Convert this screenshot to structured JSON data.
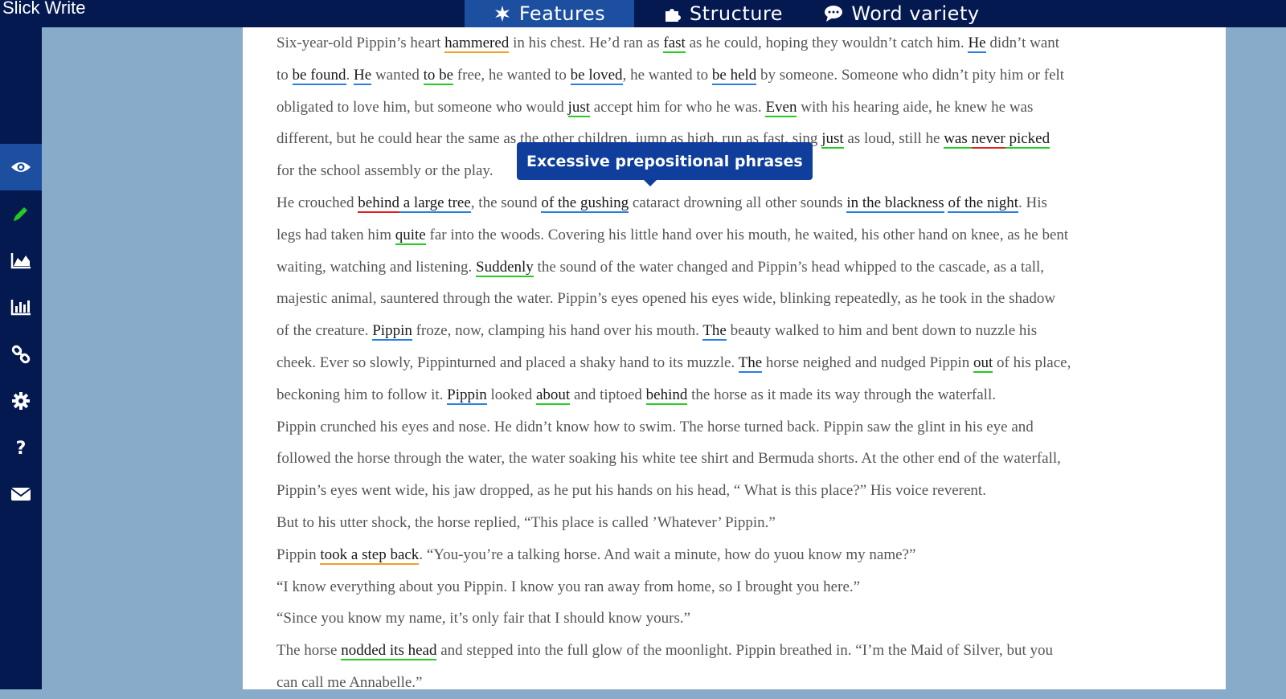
{
  "app": {
    "title": "Slick Write"
  },
  "tabs": [
    {
      "label": "Features",
      "icon": "puzzle-star-icon",
      "active": true
    },
    {
      "label": "Structure",
      "icon": "puzzle-icon",
      "active": false
    },
    {
      "label": "Word variety",
      "icon": "speech-bubble-icon",
      "active": false
    }
  ],
  "sidebar": {
    "items": [
      {
        "icon": "eye-icon",
        "active": true
      },
      {
        "icon": "pencil-icon",
        "active": false
      },
      {
        "icon": "area-chart-icon",
        "active": false
      },
      {
        "icon": "bar-chart-icon",
        "active": false
      },
      {
        "icon": "link-icon",
        "active": false
      },
      {
        "icon": "gear-icon",
        "active": false
      },
      {
        "icon": "question-icon",
        "active": false
      },
      {
        "icon": "envelope-icon",
        "active": false
      }
    ]
  },
  "colors": {
    "topbar": "#04194f",
    "active_tab": "#1c4fa0",
    "background": "#87abc9",
    "underline_orange": "#f0a020",
    "underline_green": "#22cc22",
    "underline_blue": "#2a7ee0",
    "underline_red": "#e02020"
  },
  "tooltip": {
    "text": "Excessive prepositional phrases"
  },
  "document": {
    "lines": [
      [
        [
          "Six-year-old Pippin’s heart ",
          ""
        ],
        [
          "hammered",
          "orange"
        ],
        [
          " in his chest. He’d ran as ",
          ""
        ],
        [
          "fast",
          "green"
        ],
        [
          " as he could, hoping they wouldn’t catch him. ",
          ""
        ],
        [
          "He",
          "blue"
        ],
        [
          " didn’t want",
          ""
        ]
      ],
      [
        [
          "to ",
          ""
        ],
        [
          "be found",
          "blue"
        ],
        [
          ". ",
          ""
        ],
        [
          "He",
          "blue"
        ],
        [
          " wanted ",
          ""
        ],
        [
          "to be",
          "green"
        ],
        [
          " free, he wanted to ",
          ""
        ],
        [
          "be loved",
          "blue"
        ],
        [
          ", he wanted to ",
          ""
        ],
        [
          "be held",
          "blue"
        ],
        [
          " by someone. Someone who didn’t pity him or felt",
          ""
        ]
      ],
      [
        [
          "obligated to love him, but someone who would ",
          ""
        ],
        [
          "just",
          "green"
        ],
        [
          " accept him for who he was. ",
          ""
        ],
        [
          "Even",
          "green"
        ],
        [
          " with his hearing aide, he knew he was",
          ""
        ]
      ],
      [
        [
          "different, but he could hear the same as the other children, jump as high, run as fast, sing ",
          ""
        ],
        [
          "just",
          "green"
        ],
        [
          " as loud, still he ",
          ""
        ],
        [
          "was ",
          "green"
        ],
        [
          "never",
          "red"
        ],
        [
          " picked",
          "green"
        ]
      ],
      [
        [
          "for the school assembly or the play.",
          ""
        ]
      ],
      [
        [
          "He crouched ",
          ""
        ],
        [
          "behind",
          "red"
        ],
        [
          " a large tree",
          "blue"
        ],
        [
          ", the sound ",
          ""
        ],
        [
          "of the gushing",
          "blue"
        ],
        [
          " cataract drowning all other sounds ",
          ""
        ],
        [
          "in the blackness",
          "blue"
        ],
        [
          " ",
          ""
        ],
        [
          "of the night",
          "blue"
        ],
        [
          ". His",
          ""
        ]
      ],
      [
        [
          "legs had taken him ",
          ""
        ],
        [
          "quite",
          "green"
        ],
        [
          " far into the woods. Covering his little hand over his mouth, he waited, his other hand on knee, as he bent",
          ""
        ]
      ],
      [
        [
          "waiting, watching and listening. ",
          ""
        ],
        [
          "Suddenly",
          "green"
        ],
        [
          " the sound of the water changed and Pippin’s head whipped to the cascade, as a tall,",
          ""
        ]
      ],
      [
        [
          "majestic animal, sauntered through the water. Pippin’s eyes opened his eyes wide, blinking repeatedly, as he took in the shadow",
          ""
        ]
      ],
      [
        [
          "of the creature. ",
          ""
        ],
        [
          "Pippin",
          "blue"
        ],
        [
          " froze, now, clamping his hand over his mouth. ",
          ""
        ],
        [
          "The",
          "blue"
        ],
        [
          " beauty walked to him and bent down to nuzzle his",
          ""
        ]
      ],
      [
        [
          "cheek. Ever so slowly, Pippinturned and placed a shaky hand to its muzzle. ",
          ""
        ],
        [
          "The",
          "blue"
        ],
        [
          " horse neighed and nudged Pippin ",
          ""
        ],
        [
          "out",
          "green"
        ],
        [
          " of his place,",
          ""
        ]
      ],
      [
        [
          "beckoning him to follow it. ",
          ""
        ],
        [
          "Pippin",
          "blue"
        ],
        [
          " looked ",
          ""
        ],
        [
          "about",
          "green"
        ],
        [
          " and tiptoed ",
          ""
        ],
        [
          "behind",
          "green"
        ],
        [
          " the horse as it made its way through the waterfall.",
          ""
        ]
      ],
      [
        [
          "Pippin crunched his eyes and nose. He didn’t know how to swim. The horse turned back. Pippin saw the glint in his eye and",
          ""
        ]
      ],
      [
        [
          "followed the horse through the water, the water soaking his white tee shirt and Bermuda shorts. At the other end of the waterfall,",
          ""
        ]
      ],
      [
        [
          "Pippin’s eyes went wide, his jaw dropped,  as he put his hands on his head, “ What is this place?” His voice reverent.",
          ""
        ]
      ],
      [
        [
          "But to his utter shock, the horse replied, “This place is called ’Whatever’ Pippin.”",
          ""
        ]
      ],
      [
        [
          "Pippin ",
          ""
        ],
        [
          "took a step back",
          "orange"
        ],
        [
          ". “You-you’re a talking horse. And wait a minute, how do yuou know my name?”",
          ""
        ]
      ],
      [
        [
          "“I know everything about you Pippin. I know you ran away from home, so I brought you here.”",
          ""
        ]
      ],
      [
        [
          "“Since you know my name, it’s only fair that I should know yours.”",
          ""
        ]
      ],
      [
        [
          "The horse ",
          ""
        ],
        [
          "nodded its head",
          "green"
        ],
        [
          " and stepped into the full glow of the moonlight. Pippin breathed in. “I’m the Maid of Silver, but you",
          ""
        ]
      ],
      [
        [
          "can call me Annabelle.”",
          ""
        ]
      ]
    ]
  }
}
